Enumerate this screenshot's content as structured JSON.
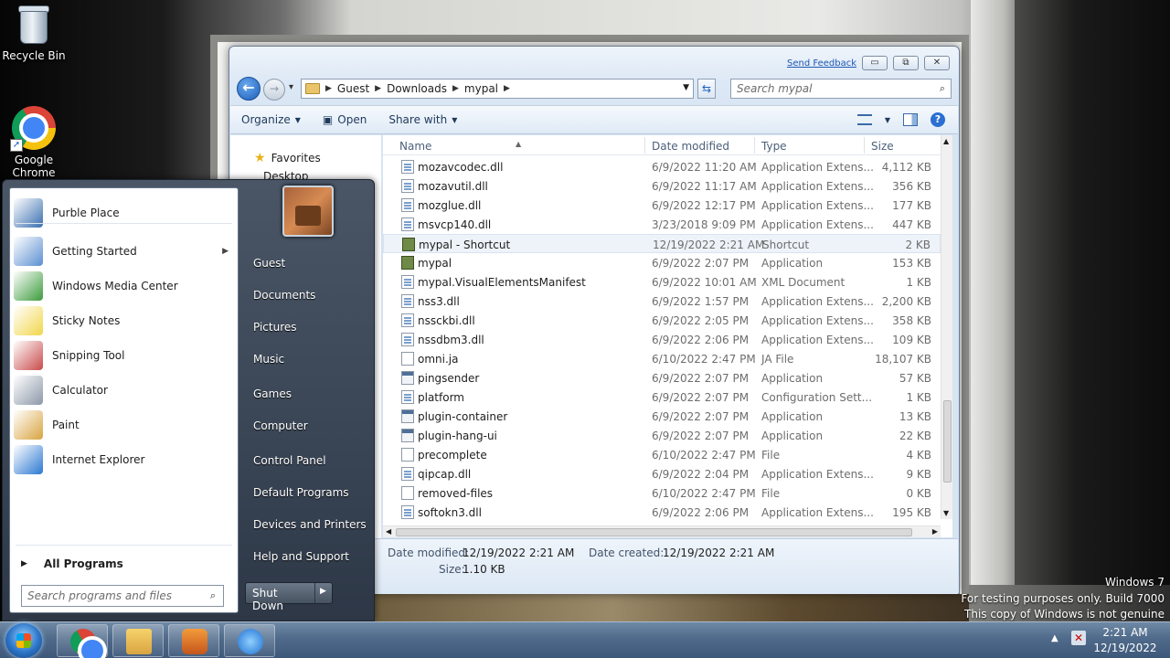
{
  "desktop": {
    "icons": [
      {
        "label": "Recycle Bin"
      },
      {
        "label": "Google Chrome"
      }
    ],
    "watermark": {
      "line1": "Windows 7",
      "line2": "For testing purposes only. Build 7000",
      "line3": "This copy of Windows is not genuine"
    }
  },
  "explorer": {
    "send_feedback": "Send Feedback",
    "title_buttons": {
      "minimize": "▭",
      "maximize": "⧉",
      "close": "✕"
    },
    "breadcrumb": [
      "Guest",
      "Downloads",
      "mypal"
    ],
    "search_placeholder": "Search mypal",
    "toolbar": {
      "organize": "Organize",
      "open": "Open",
      "share_with": "Share with"
    },
    "nav": {
      "favorites": "Favorites",
      "desktop": "Desktop"
    },
    "columns": {
      "name": "Name",
      "date": "Date modified",
      "type": "Type",
      "size": "Size"
    },
    "files": [
      {
        "name": "mozavcodec.dll",
        "date": "6/9/2022 11:20 AM",
        "type": "Application Extens...",
        "size": "4,112 KB",
        "icon": "dll"
      },
      {
        "name": "mozavutil.dll",
        "date": "6/9/2022 11:17 AM",
        "type": "Application Extens...",
        "size": "356 KB",
        "icon": "dll"
      },
      {
        "name": "mozglue.dll",
        "date": "6/9/2022 12:17 PM",
        "type": "Application Extens...",
        "size": "177 KB",
        "icon": "dll"
      },
      {
        "name": "msvcp140.dll",
        "date": "3/23/2018 9:09 PM",
        "type": "Application Extens...",
        "size": "447 KB",
        "icon": "dll"
      },
      {
        "name": "mypal - Shortcut",
        "date": "12/19/2022 2:21 AM",
        "type": "Shortcut",
        "size": "2 KB",
        "icon": "mypal"
      },
      {
        "name": "mypal",
        "date": "6/9/2022 2:07 PM",
        "type": "Application",
        "size": "153 KB",
        "icon": "mypal"
      },
      {
        "name": "mypal.VisualElementsManifest",
        "date": "6/9/2022 10:01 AM",
        "type": "XML Document",
        "size": "1 KB",
        "icon": "dll"
      },
      {
        "name": "nss3.dll",
        "date": "6/9/2022 1:57 PM",
        "type": "Application Extens...",
        "size": "2,200 KB",
        "icon": "dll"
      },
      {
        "name": "nssckbi.dll",
        "date": "6/9/2022 2:05 PM",
        "type": "Application Extens...",
        "size": "358 KB",
        "icon": "dll"
      },
      {
        "name": "nssdbm3.dll",
        "date": "6/9/2022 2:06 PM",
        "type": "Application Extens...",
        "size": "109 KB",
        "icon": "dll"
      },
      {
        "name": "omni.ja",
        "date": "6/10/2022 2:47 PM",
        "type": "JA File",
        "size": "18,107 KB",
        "icon": "file"
      },
      {
        "name": "pingsender",
        "date": "6/9/2022 2:07 PM",
        "type": "Application",
        "size": "57 KB",
        "icon": "app"
      },
      {
        "name": "platform",
        "date": "6/9/2022 2:07 PM",
        "type": "Configuration Sett...",
        "size": "1 KB",
        "icon": "dll"
      },
      {
        "name": "plugin-container",
        "date": "6/9/2022 2:07 PM",
        "type": "Application",
        "size": "13 KB",
        "icon": "app"
      },
      {
        "name": "plugin-hang-ui",
        "date": "6/9/2022 2:07 PM",
        "type": "Application",
        "size": "22 KB",
        "icon": "app"
      },
      {
        "name": "precomplete",
        "date": "6/10/2022 2:47 PM",
        "type": "File",
        "size": "4 KB",
        "icon": "file"
      },
      {
        "name": "qipcap.dll",
        "date": "6/9/2022 2:04 PM",
        "type": "Application Extens...",
        "size": "9 KB",
        "icon": "dll"
      },
      {
        "name": "removed-files",
        "date": "6/10/2022 2:47 PM",
        "type": "File",
        "size": "0 KB",
        "icon": "file"
      },
      {
        "name": "softokn3.dll",
        "date": "6/9/2022 2:06 PM",
        "type": "Application Extens...",
        "size": "195 KB",
        "icon": "dll"
      }
    ],
    "details": {
      "date_modified_label": "Date modified:",
      "date_modified": "12/19/2022 2:21 AM",
      "date_created_label": "Date created:",
      "date_created": "12/19/2022 2:21 AM",
      "size_label": "Size:",
      "size": "1.10 KB"
    }
  },
  "start_menu": {
    "programs": [
      {
        "label": "Purble Place",
        "color": "#3a6fb0"
      },
      {
        "label": "Getting Started",
        "color": "#5b8fd1"
      },
      {
        "label": "Windows Media Center",
        "color": "#3c9b3c"
      },
      {
        "label": "Sticky Notes",
        "color": "#f2d64b"
      },
      {
        "label": "Snipping Tool",
        "color": "#c94a4a"
      },
      {
        "label": "Calculator",
        "color": "#8c98a8"
      },
      {
        "label": "Paint",
        "color": "#d9a441"
      },
      {
        "label": "Internet Explorer",
        "color": "#2b78d1"
      }
    ],
    "all_programs": "All Programs",
    "search_placeholder": "Search programs and files",
    "places": [
      "Guest",
      "Documents",
      "Pictures",
      "Music",
      "Games",
      "Computer",
      "Control Panel",
      "Default Programs",
      "Devices and Printers",
      "Help and Support"
    ],
    "shutdown": "Shut Down"
  },
  "taskbar": {
    "time": "2:21 AM",
    "date": "12/19/2022"
  }
}
